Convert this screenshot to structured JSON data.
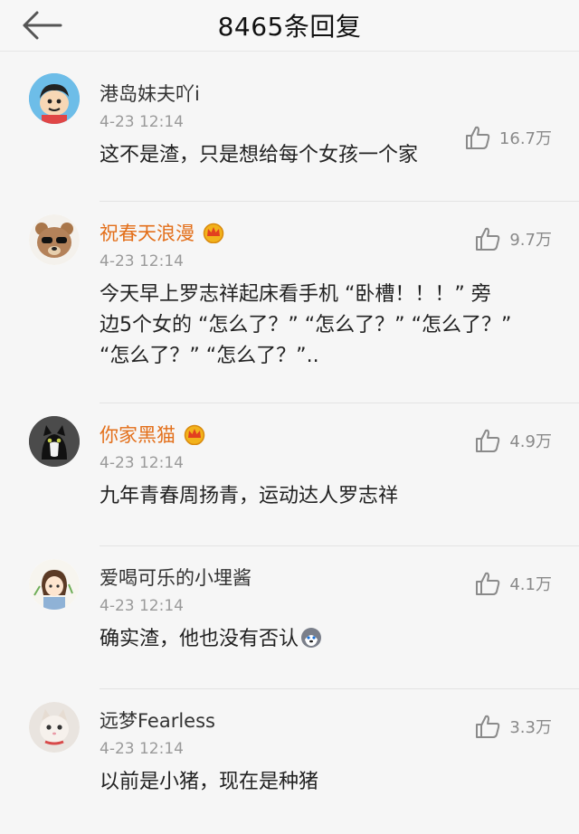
{
  "header": {
    "title": "8465条回复"
  },
  "comments": [
    {
      "name": "港岛妹夫吖i",
      "time": "4-23 12:14",
      "likes": "16.7万",
      "text": "这不是渣，只是想给每个女孩一个家"
    },
    {
      "name": "祝春天浪漫",
      "time": "4-23 12:14",
      "likes": "9.7万",
      "text_lines": [
        "今天早上罗志祥起床看手机 “卧槽！！！” 旁",
        "边5个女的 “怎么了？” “怎么了？” “怎么了？”",
        "“怎么了？” “怎么了？”.."
      ]
    },
    {
      "name": "你家黑猫",
      "time": "4-23 12:14",
      "likes": "4.9万",
      "text": "九年青春周扬青，运动达人罗志祥"
    },
    {
      "name": "爱喝可乐的小埋酱",
      "time": "4-23 12:14",
      "likes": "4.1万",
      "text": "确实渣，他也没有否认"
    },
    {
      "name": "远梦Fearless",
      "time": "4-23 12:14",
      "likes": "3.3万",
      "text": "以前是小猪，现在是种猪"
    }
  ],
  "colors": {
    "vip_name": "#e36f1a",
    "normal_name": "#333333",
    "time": "#9a9a9a",
    "crown": "#f2b21b"
  }
}
